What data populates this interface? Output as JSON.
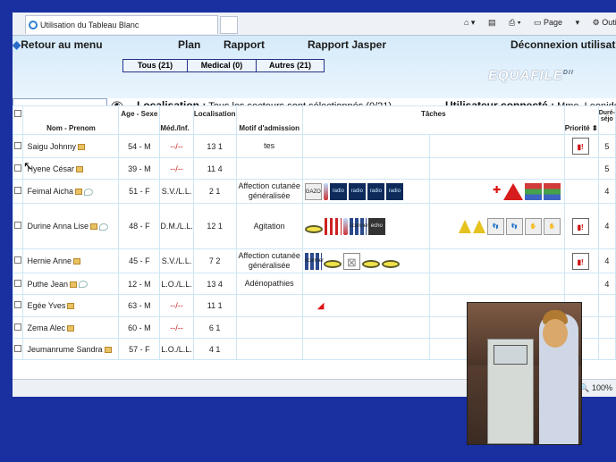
{
  "browser": {
    "tab_title": "Utilisation du Tableau Blanc",
    "tools": [
      "Page",
      "Outils"
    ]
  },
  "nav": {
    "back": "Retour au menu",
    "plan": "Plan",
    "report": "Rapport",
    "report_jasper": "Rapport Jasper",
    "logout": "Déconnexion utilisat"
  },
  "filters": [
    "Tous (21)",
    "Medical (0)",
    "Autres (21)"
  ],
  "logo": {
    "text": "EQUAFILE",
    "sup": "DII"
  },
  "localisation": {
    "label": "Localisation :",
    "value": "Tous les secteurs sont sélectionnés (0/21)"
  },
  "user": {
    "label": "Utilisateur connecté :",
    "value": "Mme. Leonide"
  },
  "columns": {
    "name": "Nom - Prenom",
    "age": "Age - Sexe",
    "med": "Méd./Inf.",
    "loc": "Localisation",
    "motif": "Motif d'admission",
    "tasks": "Tâches",
    "priority": "Priorité",
    "duration": "Duré­séjo"
  },
  "rows": [
    {
      "name": "Saigu Johnny",
      "age": "54 - M",
      "med": "--/--",
      "loc": "13 1",
      "motif": "tes",
      "dur": "5",
      "speech": false
    },
    {
      "name": "Hyene César",
      "age": "39 - M",
      "med": "--/--",
      "loc": "11 4",
      "motif": "",
      "dur": "5",
      "speech": false
    },
    {
      "name": "Feimal Aicha",
      "age": "51 - F",
      "med": "S.V./L.L.",
      "loc": "2 1",
      "motif": "Affection cutanée généralisée",
      "dur": "4",
      "speech": true
    },
    {
      "name": "Durine Anna Lise",
      "age": "48 - F",
      "med": "D.M./L.L.",
      "loc": "12 1",
      "motif": "Agitation",
      "dur": "4",
      "speech": true
    },
    {
      "name": "Hernie Anne",
      "age": "45 - F",
      "med": "S.V./L.L.",
      "loc": "7 2",
      "motif": "Affection cutanée généralisée",
      "dur": "4",
      "speech": false
    },
    {
      "name": "Puthe Jean",
      "age": "12 - M",
      "med": "L.O./L.L.",
      "loc": "13 4",
      "motif": "Adénopathies",
      "dur": "4",
      "speech": true
    },
    {
      "name": "Egée Yves",
      "age": "63 - M",
      "med": "--/--",
      "loc": "11 1",
      "motif": "",
      "dur": "",
      "speech": false
    },
    {
      "name": "Zema Alec",
      "age": "60 - M",
      "med": "--/--",
      "loc": "6 1",
      "motif": "",
      "dur": "",
      "speech": false
    },
    {
      "name": "Jeumanrume Sandra",
      "age": "57 - F",
      "med": "L.O./L.L.",
      "loc": "4 1",
      "motif": "",
      "dur": "",
      "speech": false
    }
  ],
  "task_labels": {
    "radio": "radio",
    "gazo": "GAZO",
    "scanner": "scanner",
    "echo": "echo"
  },
  "zoom": "100%"
}
